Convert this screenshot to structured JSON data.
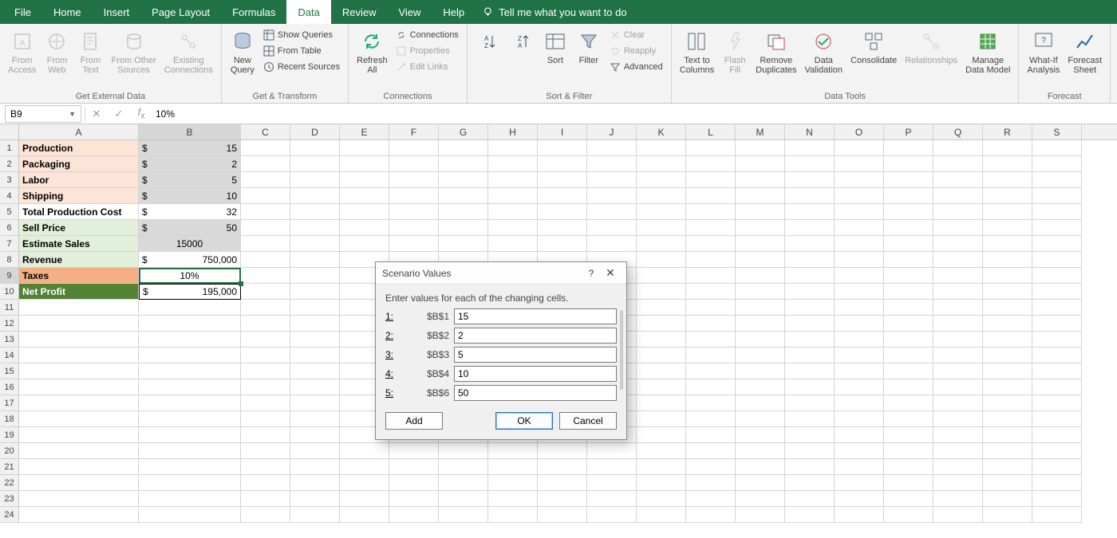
{
  "menu": {
    "tabs": [
      "File",
      "Home",
      "Insert",
      "Page Layout",
      "Formulas",
      "Data",
      "Review",
      "View",
      "Help"
    ],
    "active": "Data",
    "tellme": "Tell me what you want to do"
  },
  "ribbon": {
    "groups": {
      "getdata": {
        "label": "Get External Data",
        "access": "From\nAccess",
        "web": "From\nWeb",
        "text": "From\nText",
        "other": "From Other\nSources",
        "existing": "Existing\nConnections"
      },
      "transform": {
        "label": "Get & Transform",
        "newq": "New\nQuery",
        "showq": "Show Queries",
        "table": "From Table",
        "recent": "Recent Sources"
      },
      "connections": {
        "label": "Connections",
        "refresh": "Refresh\nAll",
        "conns": "Connections",
        "props": "Properties",
        "edit": "Edit Links"
      },
      "sortfilter": {
        "label": "Sort & Filter",
        "sort": "Sort",
        "filter": "Filter",
        "clear": "Clear",
        "reapply": "Reapply",
        "advanced": "Advanced"
      },
      "datatools": {
        "label": "Data Tools",
        "ttc": "Text to\nColumns",
        "flash": "Flash\nFill",
        "remdup": "Remove\nDuplicates",
        "valid": "Data\nValidation",
        "consol": "Consolidate",
        "rel": "Relationships",
        "model": "Manage\nData Model"
      },
      "forecast": {
        "label": "Forecast",
        "whatif": "What-If\nAnalysis",
        "sheet": "Forecast\nSheet"
      }
    }
  },
  "formulabar": {
    "name": "B9",
    "value": "10%"
  },
  "columns": [
    "A",
    "B",
    "C",
    "D",
    "E",
    "F",
    "G",
    "H",
    "I",
    "J",
    "K",
    "L",
    "M",
    "N",
    "O",
    "P",
    "Q",
    "R",
    "S"
  ],
  "sheet": {
    "r1": {
      "a": "Production",
      "b_sym": "$",
      "b_val": "15"
    },
    "r2": {
      "a": "Packaging",
      "b_sym": "$",
      "b_val": "2"
    },
    "r3": {
      "a": "Labor",
      "b_sym": "$",
      "b_val": "5"
    },
    "r4": {
      "a": "Shipping",
      "b_sym": "$",
      "b_val": "10"
    },
    "r5": {
      "a": "Total Production Cost",
      "b_sym": "$",
      "b_val": "32"
    },
    "r6": {
      "a": "Sell Price",
      "b_sym": "$",
      "b_val": "50"
    },
    "r7": {
      "a": "Estimate Sales",
      "b": "15000"
    },
    "r8": {
      "a": "Revenue",
      "b_sym": "$",
      "b_val": "750,000"
    },
    "r9": {
      "a": "Taxes",
      "b": "10%"
    },
    "r10": {
      "a": "Net Profit",
      "b_sym": "$",
      "b_val": "195,000"
    }
  },
  "dialog": {
    "title": "Scenario Values",
    "instr": "Enter values for each of the changing cells.",
    "rows": [
      {
        "n": "1:",
        "ref": "$B$1",
        "val": "15"
      },
      {
        "n": "2:",
        "ref": "$B$2",
        "val": "2"
      },
      {
        "n": "3:",
        "ref": "$B$3",
        "val": "5"
      },
      {
        "n": "4:",
        "ref": "$B$4",
        "val": "10"
      },
      {
        "n": "5:",
        "ref": "$B$6",
        "val": "50"
      }
    ],
    "add": "Add",
    "ok": "OK",
    "cancel": "Cancel"
  }
}
